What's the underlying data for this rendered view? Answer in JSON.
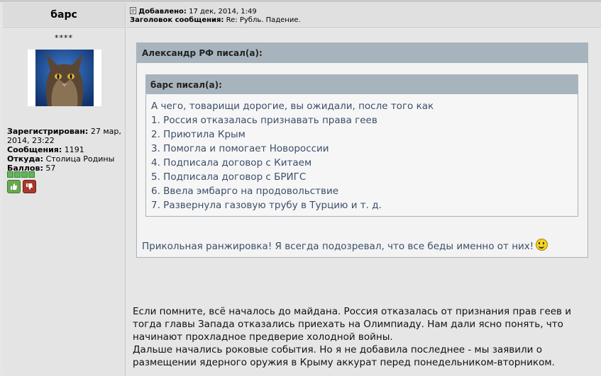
{
  "author": {
    "name": "барс",
    "rank": "****",
    "registered_label": "Зарегистрирован:",
    "registered_value": "27 мар, 2014, 23:22",
    "posts_label": "Сообщения:",
    "posts_value": "1191",
    "from_label": "Откуда:",
    "from_value": "Столица Родины",
    "points_label": "Баллов:",
    "points_value": "57"
  },
  "post": {
    "added_label": "Добавлено:",
    "added_value": "17 дек, 2014, 1:49",
    "subject_label": "Заголовок сообщения:",
    "subject_value": "Re: Рубль. Падение."
  },
  "quote_outer": {
    "header": "Александр РФ писал(а):",
    "reply": "Прикольная ранжировка! Я всегда подозревал, что все беды именно от них!"
  },
  "quote_inner": {
    "header": "барс писал(а):",
    "lines": [
      "А чего, товарищи дорогие, вы ожидали, после того как",
      "1. Россия отказалась признавать права геев",
      "2. Приютила Крым",
      "3. Помогла и помогает Новороссии",
      "4. Подписала договор с Китаем",
      "5. Подписала договор с БРИГС",
      "6. Ввела эмбарго на продовольствие",
      "7. Развернула газовую трубу в Турцию и т. д."
    ]
  },
  "body_lines": [
    "Если помните, всё началось до майдана. Россия отказалась от признания прав геев и",
    "тогда главы Запада отказались приехать на Олимпиаду. Нам дали ясно понять, что",
    "начинают прохладное предверие холодной войны.",
    "Дальше начались роковые события. Но я не добавила последнее - мы заявили о",
    "размещении ядерного оружия в Крыму аккурат перед понедельником-вторником."
  ],
  "icons": {
    "post": "post-icon",
    "vote_up": "thumbs-up-icon",
    "vote_down": "thumbs-down-icon",
    "smile": "smile-icon"
  }
}
